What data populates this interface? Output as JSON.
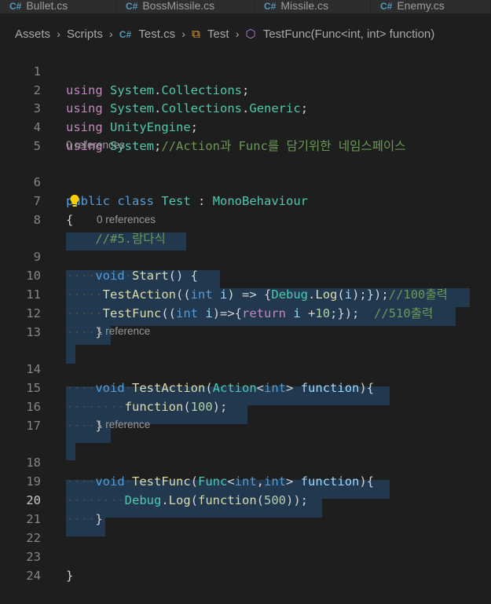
{
  "tabs": [
    {
      "label": "Bullet.cs"
    },
    {
      "label": "BossMissile.cs"
    },
    {
      "label": "Missile.cs"
    },
    {
      "label": "Enemy.cs"
    }
  ],
  "breadcrumb": {
    "assets": "Assets",
    "scripts": "Scripts",
    "file": "Test.cs",
    "class": "Test",
    "method": "TestFunc(Func<int, int> function)"
  },
  "lenses": {
    "class_refs": "0 references",
    "start_refs": "0 references",
    "testaction_refs": "1 reference",
    "testfunc_refs": "1 reference"
  },
  "line_numbers": [
    "1",
    "2",
    "3",
    "4",
    "5",
    "6",
    "7",
    "8",
    "9",
    "10",
    "11",
    "12",
    "13",
    "14",
    "15",
    "16",
    "17",
    "18",
    "19",
    "20",
    "21",
    "22",
    "23",
    "24"
  ],
  "code": {
    "l1": {
      "kw": "using",
      "ns1": "System",
      "dot": ".",
      "ns2": "Collections",
      "end": ";"
    },
    "l2": {
      "kw": "using",
      "ns1": "System",
      "dot1": ".",
      "ns2": "Collections",
      "dot2": ".",
      "ns3": "Generic",
      "end": ";"
    },
    "l3": {
      "kw": "using",
      "ns1": "UnityEngine",
      "end": ";"
    },
    "l4": {
      "kw": "using",
      "ns1": "System",
      "end": ";",
      "comment": "//Action과 Func를 담기위한 네임스페이스"
    },
    "l6": {
      "kw1": "public",
      "kw2": "class",
      "name": "Test",
      "colon": " : ",
      "base": "MonoBehaviour"
    },
    "l7": {
      "brace": "{"
    },
    "l8": {
      "comment": "//#5.람다식"
    },
    "l9": {
      "kw": "void",
      "fn": "Start",
      "rest": "() {"
    },
    "l10": {
      "fn": "TestAction",
      "p1": "((",
      "t": "int",
      "sp": " ",
      "v": "i",
      "p2": ") => {",
      "cls": "Debug",
      "dot": ".",
      "fn2": "Log",
      "p3": "(",
      "v2": "i",
      "p4": ");});",
      "comment": "//100출력"
    },
    "l11": {
      "fn": "TestFunc",
      "p1": "((",
      "t": "int",
      "sp": " ",
      "v": "i",
      "p2": ")=>{",
      "kw": "return",
      "sp2": " ",
      "v2": "i",
      "op": " +",
      "num": "10",
      "p3": ";});  ",
      "comment": "//510출력"
    },
    "l12": {
      "brace": "}"
    },
    "l14": {
      "kw": "void",
      "fn": "TestAction",
      "p1": "(",
      "ty": "Action",
      "lt": "<",
      "t": "int",
      "gt": ">",
      "sp": " ",
      "pa": "function",
      "p2": "){"
    },
    "l15": {
      "fn": "function",
      "p1": "(",
      "num": "100",
      "p2": ");"
    },
    "l16": {
      "brace": "}"
    },
    "l18": {
      "kw": "void",
      "fn": "TestFunc",
      "p1": "(",
      "ty": "Func",
      "lt": "<",
      "t1": "int",
      "cm": ",",
      "t2": "int",
      "gt": ">",
      "sp": " ",
      "pa": "function",
      "p2": "){"
    },
    "l19": {
      "cls": "Debug",
      "dot": ".",
      "fn": "Log",
      "p1": "(",
      "fn2": "function",
      "p2": "(",
      "num": "500",
      "p3": "));"
    },
    "l20": {
      "brace": "}"
    },
    "l23": {
      "brace": "}"
    }
  },
  "colors": {
    "keyword": "#569cd6",
    "type": "#4ec9b0",
    "function": "#dcdcaa",
    "number": "#b5cea8",
    "comment": "#6a9955",
    "control": "#c586c0",
    "parameter": "#9cdcfe",
    "selection": "#264f78"
  },
  "icons": {
    "tab": "csharp-file-icon",
    "bulb": "lightbulb-icon",
    "class": "class-symbol-icon",
    "method": "method-symbol-icon"
  }
}
